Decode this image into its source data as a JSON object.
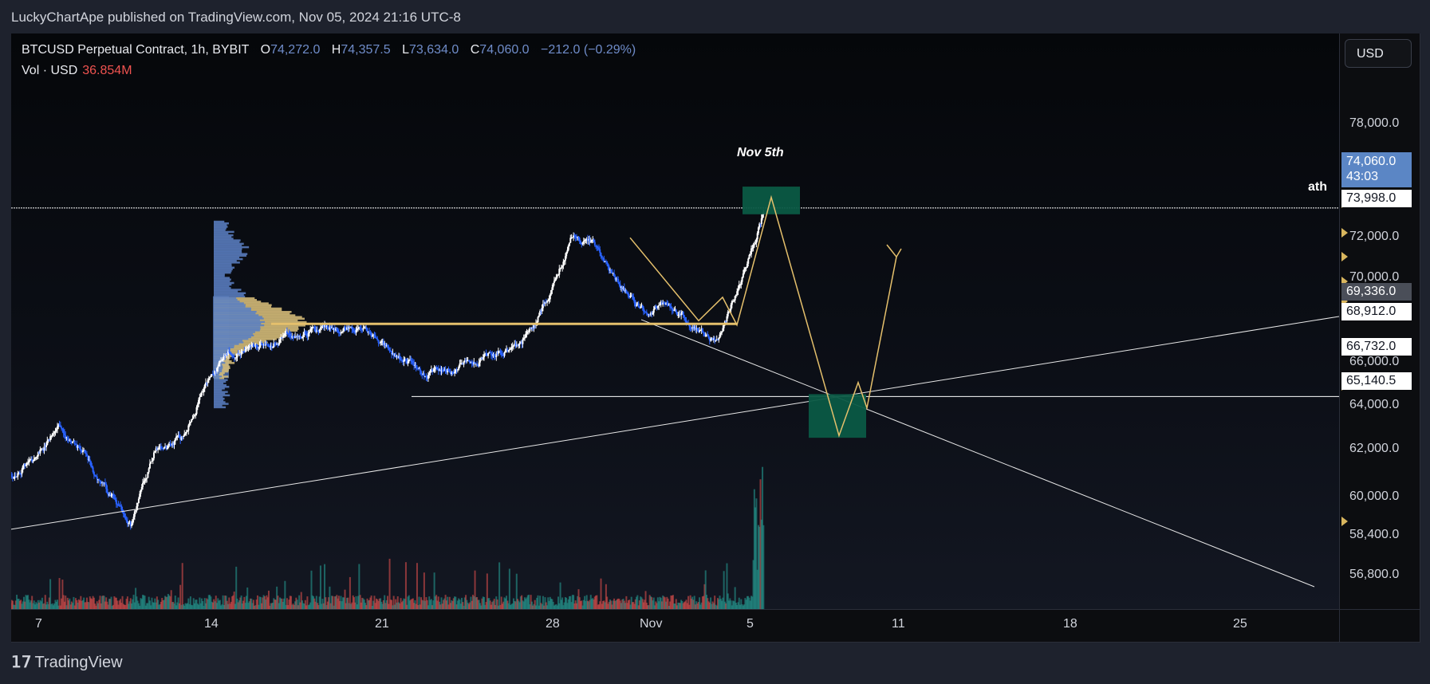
{
  "header": {
    "publisher": "LuckyChartApe published on TradingView.com, Nov 05, 2024 21:16 UTC-8"
  },
  "legend": {
    "symbol": "BTCUSD Perpetual Contract, 1h, BYBIT",
    "o_label": "O",
    "o": "74,272.0",
    "h_label": "H",
    "h": "74,357.5",
    "l_label": "L",
    "l": "73,634.0",
    "c_label": "C",
    "c": "74,060.0",
    "change": "−212.0 (−0.29%)",
    "vol_label": "Vol · USD",
    "vol": "36.854M"
  },
  "currency_button": "USD",
  "annotations": {
    "date_label": "Nov 5th",
    "ath_label": "ath"
  },
  "price_badges": {
    "last": "74,060.0",
    "countdown": "43:03",
    "ath_level": "73,998.0",
    "mid_level": "69,336.0",
    "level_68912": "68,912.0",
    "level_66732": "66,732.0",
    "level_65140": "65,140.5"
  },
  "footer": {
    "brand": "TradingView"
  },
  "colors": {
    "candle_up": "#ffffff",
    "candle_down": "#2962ff",
    "volume_up": "#26a69a",
    "volume_down": "#ef5350",
    "projection": "#e5c06c",
    "trendline": "#e8e8e8",
    "zone": "#0b5a45",
    "last_price_badge": "#5b86c5"
  },
  "chart_data": {
    "type": "candlestick",
    "title": "BTCUSD Perpetual Contract, 1h, BYBIT",
    "y_ticks": [
      "78,000.0",
      "72,000.0",
      "70,000.0",
      "66,000.0",
      "64,000.0",
      "62,000.0",
      "60,000.0",
      "58,400.0",
      "56,800.0"
    ],
    "x_ticks": [
      "7",
      "14",
      "21",
      "28",
      "Nov",
      "5",
      "11",
      "18",
      "25"
    ],
    "ylim": [
      55000,
      80000
    ],
    "approx_close_path": [
      {
        "x": "Oct 7",
        "y": 62200
      },
      {
        "x": "Oct 8",
        "y": 63600
      },
      {
        "x": "Oct 9",
        "y": 62500
      },
      {
        "x": "Oct 10",
        "y": 60500
      },
      {
        "x": "Oct 11",
        "y": 59200
      },
      {
        "x": "Oct 12",
        "y": 62800
      },
      {
        "x": "Oct 13",
        "y": 63200
      },
      {
        "x": "Oct 14",
        "y": 65800
      },
      {
        "x": "Oct 15",
        "y": 67200
      },
      {
        "x": "Oct 16",
        "y": 67500
      },
      {
        "x": "Oct 18",
        "y": 68100
      },
      {
        "x": "Oct 20",
        "y": 68600
      },
      {
        "x": "Oct 22",
        "y": 67000
      },
      {
        "x": "Oct 23",
        "y": 66200
      },
      {
        "x": "Oct 25",
        "y": 66800
      },
      {
        "x": "Oct 27",
        "y": 67700
      },
      {
        "x": "Oct 28",
        "y": 69600
      },
      {
        "x": "Oct 29",
        "y": 72600
      },
      {
        "x": "Oct 30",
        "y": 72200
      },
      {
        "x": "Oct 31",
        "y": 70400
      },
      {
        "x": "Nov 1",
        "y": 69200
      },
      {
        "x": "Nov 2",
        "y": 69400
      },
      {
        "x": "Nov 3",
        "y": 68600
      },
      {
        "x": "Nov 4",
        "y": 67500
      },
      {
        "x": "Nov 5",
        "y": 70500
      },
      {
        "x": "Nov 6",
        "y": 74060
      }
    ],
    "horizontal_levels": [
      73998.0,
      68912.0,
      65140.5
    ],
    "last_price": 74060.0
  }
}
